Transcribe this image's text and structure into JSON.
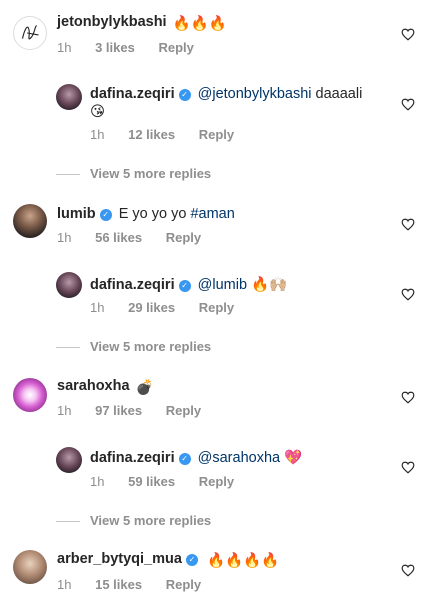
{
  "comments": [
    {
      "username": "jetonbylykbashi",
      "text": "🔥🔥🔥",
      "time": "1h",
      "likes": "3 likes",
      "reply_label": "Reply",
      "replies_label": "View 5 more replies",
      "reply": {
        "username": "dafina.zeqiri",
        "mention": "@jetonbylykbashi",
        "text": "daaaali",
        "text_line2": "😘",
        "time": "1h",
        "likes": "12 likes",
        "reply_label": "Reply"
      }
    },
    {
      "username": "lumib",
      "text": "E yo yo yo",
      "hashtag": "#aman",
      "time": "1h",
      "likes": "56 likes",
      "reply_label": "Reply",
      "replies_label": "View 5 more replies",
      "reply": {
        "username": "dafina.zeqiri",
        "mention": "@lumib",
        "text": "🔥🙌🏼",
        "time": "1h",
        "likes": "29 likes",
        "reply_label": "Reply"
      }
    },
    {
      "username": "sarahoxha",
      "text": "💣",
      "time": "1h",
      "likes": "97 likes",
      "reply_label": "Reply",
      "replies_label": "View 5 more replies",
      "reply": {
        "username": "dafina.zeqiri",
        "mention": "@sarahoxha",
        "text": "💖",
        "time": "1h",
        "likes": "59 likes",
        "reply_label": "Reply"
      }
    },
    {
      "username": "arber_bytyqi_mua",
      "text": "🔥🔥🔥🔥",
      "time": "1h",
      "likes": "15 likes",
      "reply_label": "Reply"
    }
  ],
  "icons": {
    "like": "heart-outline-icon",
    "verified": "verified-badge-icon"
  },
  "colors": {
    "primary_text": "#262626",
    "secondary_text": "#8e8e8e",
    "link": "#003569",
    "verified": "#3897f0"
  }
}
